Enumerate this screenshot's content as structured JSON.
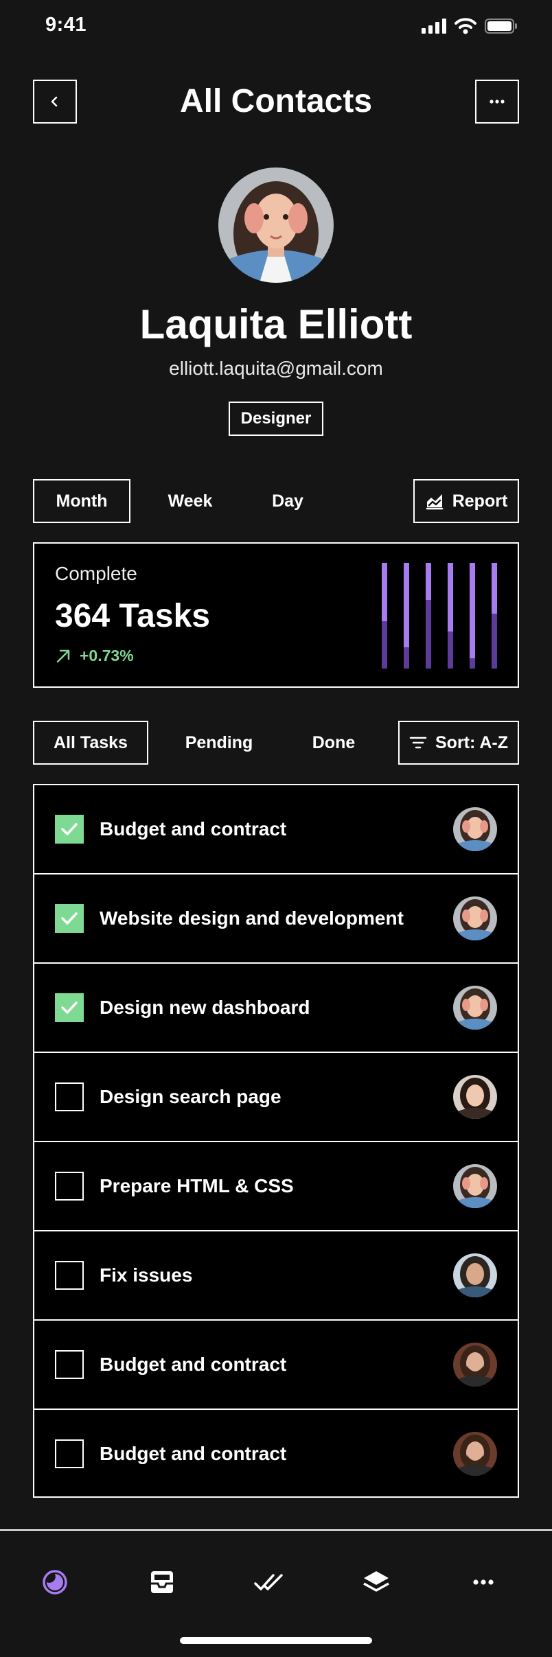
{
  "status_bar": {
    "time": "9:41"
  },
  "header": {
    "title": "All Contacts"
  },
  "profile": {
    "name": "Laquita Elliott",
    "email": "elliott.laquita@gmail.com",
    "role": "Designer"
  },
  "period_tabs": [
    {
      "label": "Month",
      "active": true
    },
    {
      "label": "Week",
      "active": false
    },
    {
      "label": "Day",
      "active": false
    }
  ],
  "report_button": {
    "label": "Report"
  },
  "stats": {
    "label": "Complete",
    "value": "364 Tasks",
    "change": "+0.73%",
    "bars": [
      {
        "fill": 0.55
      },
      {
        "fill": 0.8
      },
      {
        "fill": 0.35
      },
      {
        "fill": 0.65
      },
      {
        "fill": 0.9
      },
      {
        "fill": 0.48
      }
    ],
    "colors": {
      "bar_light": "#a67cf0",
      "bar_dark": "#5c3b99",
      "positive": "#7ed992"
    }
  },
  "filter_tabs": [
    {
      "label": "All Tasks",
      "active": true
    },
    {
      "label": "Pending",
      "active": false
    },
    {
      "label": "Done",
      "active": false
    }
  ],
  "sort_button": {
    "label": "Sort: A-Z"
  },
  "tasks": [
    {
      "label": "Budget and contract",
      "done": true,
      "avatar": "blue-shirt-woman"
    },
    {
      "label": "Website design and development",
      "done": true,
      "avatar": "blue-shirt-woman"
    },
    {
      "label": "Design new dashboard",
      "done": true,
      "avatar": "blue-shirt-woman"
    },
    {
      "label": "Design search page",
      "done": false,
      "avatar": "dark-hair-woman"
    },
    {
      "label": "Prepare HTML & CSS",
      "done": false,
      "avatar": "blue-shirt-woman"
    },
    {
      "label": "Fix issues",
      "done": false,
      "avatar": "man-outdoors"
    },
    {
      "label": "Budget and contract",
      "done": false,
      "avatar": "bearded-man"
    },
    {
      "label": "Budget and contract",
      "done": false,
      "avatar": "bearded-man"
    }
  ],
  "bottom_nav": [
    {
      "icon": "moon-icon",
      "active": true
    },
    {
      "icon": "inbox-icon",
      "active": false
    },
    {
      "icon": "double-check-icon",
      "active": false
    },
    {
      "icon": "layers-icon",
      "active": false
    },
    {
      "icon": "more-dots-icon",
      "active": false
    }
  ]
}
